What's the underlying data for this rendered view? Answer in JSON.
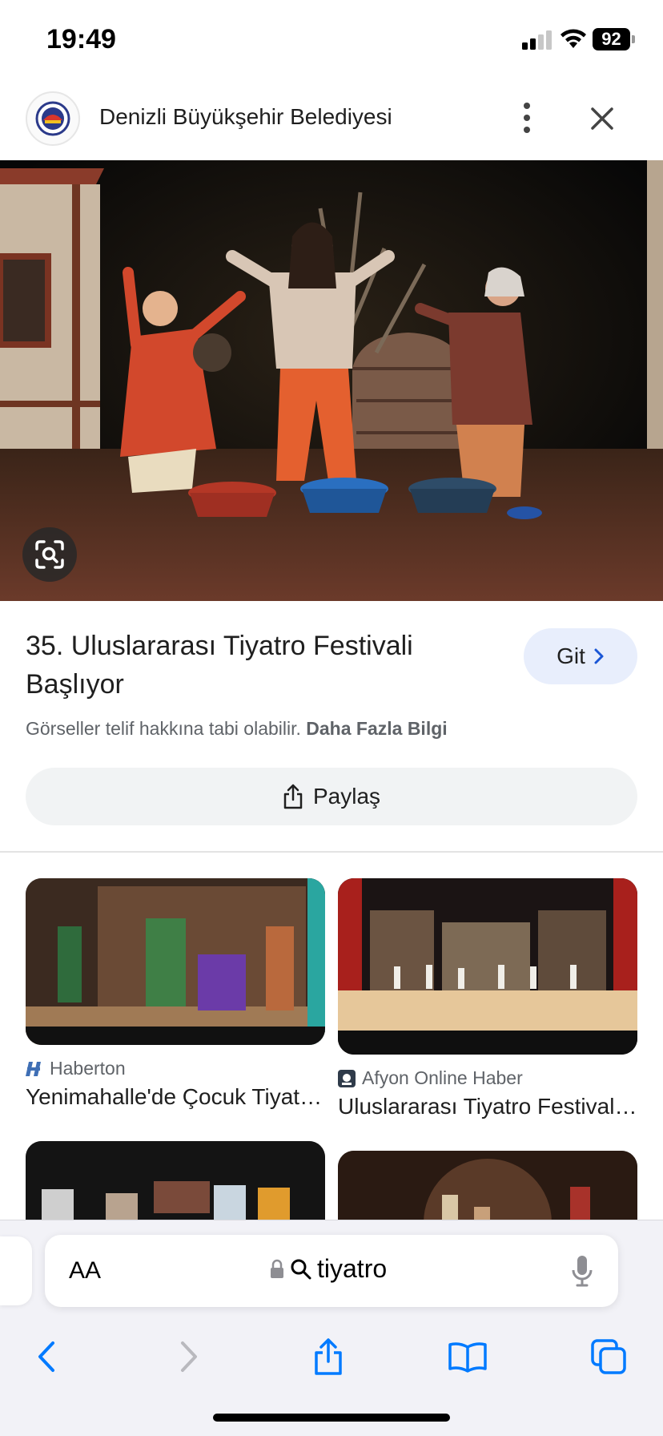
{
  "status_bar": {
    "time": "19:49",
    "battery": "92"
  },
  "header": {
    "site_name": "Denizli Büyükşehir Belediyesi"
  },
  "result": {
    "title": "35. Uluslararası Tiyatro Festivali Başlıyor",
    "go_label": "Git",
    "copyright_text": "Görseller telif hakkına tabi olabilir.",
    "more_info_link": "Daha Fazla Bilgi",
    "share_label": "Paylaş"
  },
  "related": [
    {
      "source": "Haberton",
      "title": "Yenimahalle'de Çocuk Tiyatro..."
    },
    {
      "source": "Afyon Online Haber",
      "title": "Uluslararası Tiyatro Festivali..."
    }
  ],
  "browser": {
    "text_size_label": "AA",
    "address_text": "tiyatro"
  },
  "colors": {
    "accent": "#007aff",
    "go_button_bg": "#e8eefc",
    "share_bg": "#f1f3f4"
  }
}
